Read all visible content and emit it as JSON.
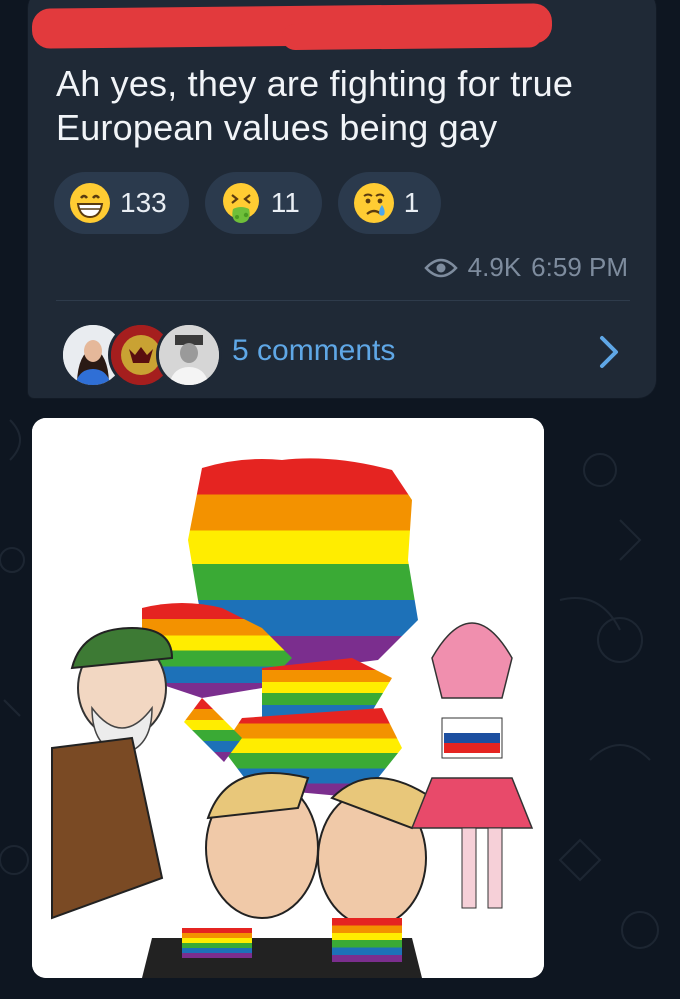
{
  "message": {
    "text": "Ah yes, they are fighting for true European values being gay"
  },
  "reactions": [
    {
      "icon": "grinning-face-icon",
      "count": "133"
    },
    {
      "icon": "nauseated-face-icon",
      "count": "11"
    },
    {
      "icon": "crying-face-icon",
      "count": "1"
    }
  ],
  "meta": {
    "views": "4.9K",
    "time": "6:59 PM",
    "views_icon": "eye-icon"
  },
  "comments": {
    "label": "5 comments"
  },
  "colors": {
    "background": "#0e1621",
    "bubble": "#1f2936",
    "link": "#5fa7e6",
    "meta": "#7e8c9e",
    "redaction": "#e23a3d"
  }
}
